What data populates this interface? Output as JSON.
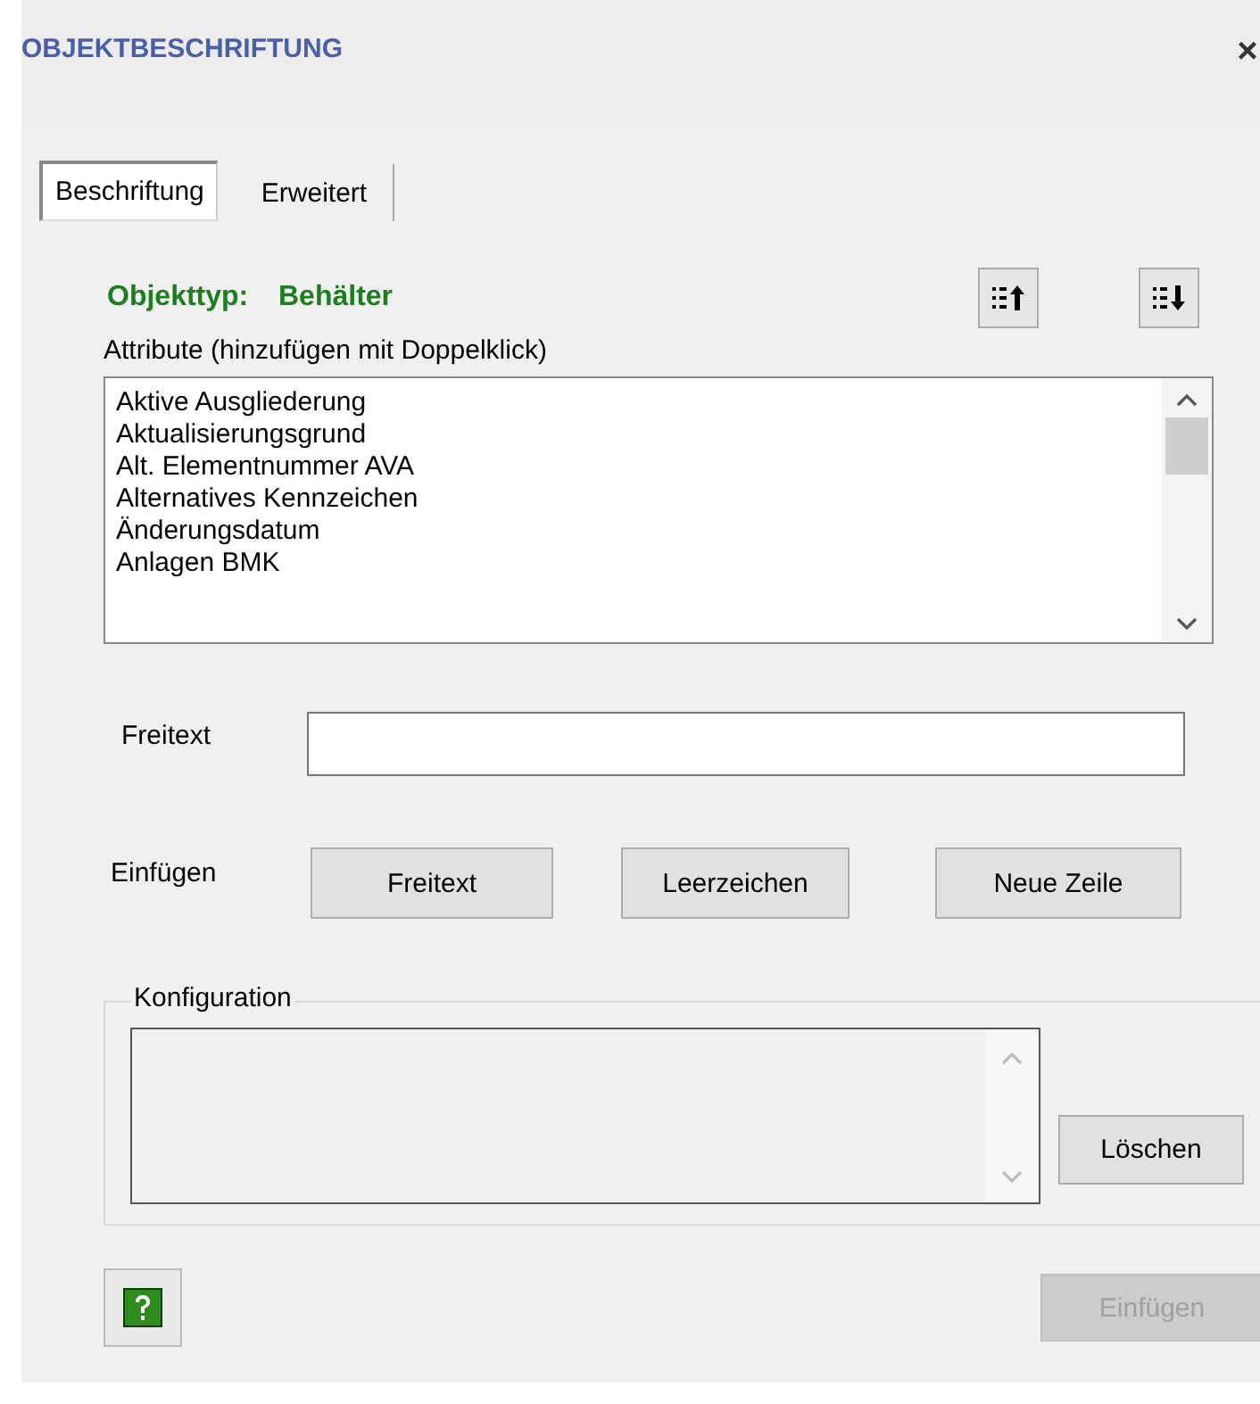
{
  "window": {
    "title": "OBJEKTBESCHRIFTUNG",
    "close": "×"
  },
  "tabs": [
    {
      "label": "Beschriftung",
      "selected": true
    },
    {
      "label": "Erweitert",
      "selected": false
    }
  ],
  "object_type": {
    "label": "Objekttyp:",
    "value": "Behälter"
  },
  "attributes": {
    "label": "Attribute (hinzufügen mit Doppelklick)",
    "items": [
      "Aktive Ausgliederung",
      "Aktualisierungsgrund",
      "Alt. Elementnummer AVA",
      "Alternatives Kennzeichen",
      "Änderungsdatum",
      "Anlagen BMK"
    ]
  },
  "freetext": {
    "label": "Freitext"
  },
  "insert": {
    "label": "Einfügen",
    "buttons": [
      "Freitext",
      "Leerzeichen",
      "Neue Zeile"
    ]
  },
  "configuration": {
    "label": "Konfiguration",
    "button": "Löschen"
  },
  "footer": {
    "button": {
      "label": "Einfügen",
      "disabled": true
    }
  }
}
